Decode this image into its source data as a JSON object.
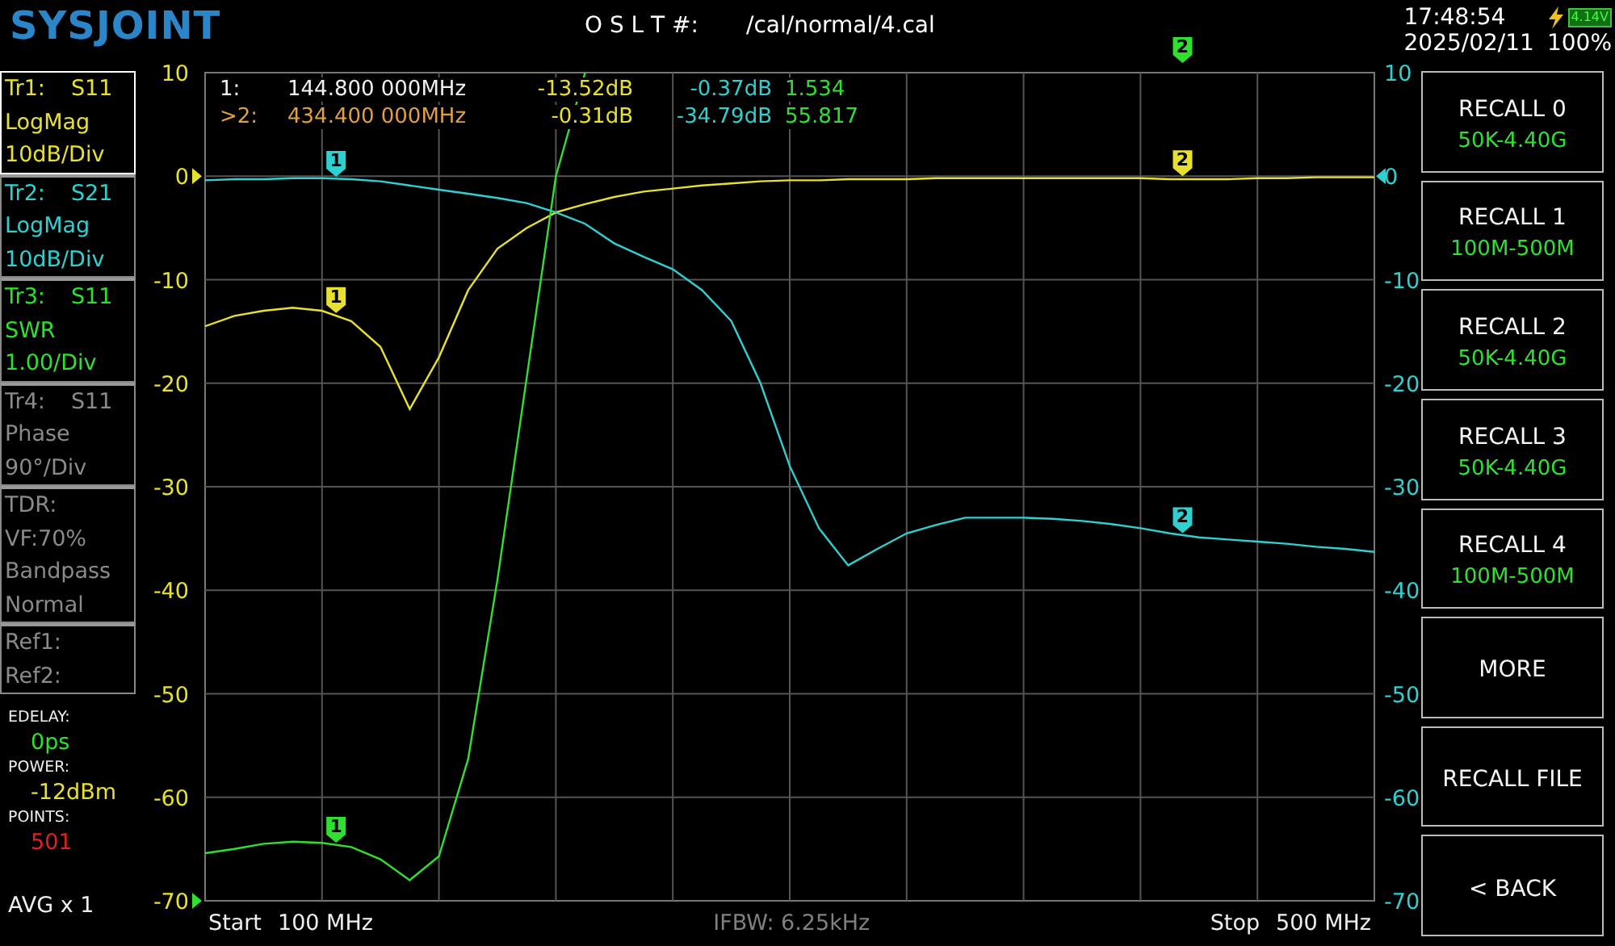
{
  "header": {
    "logo": "SYSJOINT",
    "cal_label": "O S L T #:",
    "cal_file": "/cal/normal/4.cal",
    "time": "17:48:54",
    "date": "2025/02/11",
    "battery_voltage": "4.14V",
    "battery_percent": "100%",
    "charging": true
  },
  "traces": [
    {
      "lines": [
        [
          "Tr1:",
          "S11"
        ],
        [
          "LogMag"
        ],
        [
          "10dB/Div"
        ]
      ],
      "color": "#e8e030",
      "selected": true
    },
    {
      "lines": [
        [
          "Tr2:",
          "S21"
        ],
        [
          "LogMag"
        ],
        [
          "10dB/Div"
        ]
      ],
      "color": "#30d0d0",
      "selected": false
    },
    {
      "lines": [
        [
          "Tr3:",
          "S11"
        ],
        [
          "SWR"
        ],
        [
          "1.00/Div"
        ]
      ],
      "color": "#30e030",
      "selected": false
    },
    {
      "lines": [
        [
          "Tr4:",
          "S11"
        ],
        [
          "Phase"
        ],
        [
          "90°/Div"
        ]
      ],
      "color": "#8a8a8a",
      "selected": false
    },
    {
      "lines": [
        [
          "TDR:"
        ],
        [
          "VF:70%"
        ],
        [
          "Bandpass"
        ],
        [
          "Normal"
        ]
      ],
      "color": "#8a8a8a",
      "selected": false
    },
    {
      "lines": [
        [
          "Ref1:"
        ],
        [
          "Ref2:"
        ]
      ],
      "color": "#8a8a8a",
      "selected": false
    }
  ],
  "settings": [
    {
      "label": "EDELAY:",
      "value": "0ps",
      "color": "#30e030"
    },
    {
      "label": "POWER:",
      "value": "-12dBm",
      "color": "#e8e030"
    },
    {
      "label": "POINTS:",
      "value": "501",
      "color": "#e02020"
    }
  ],
  "averaging": "AVG x 1",
  "plot": {
    "readouts": [
      {
        "label": "1:",
        "frequency": "144.800 000MHz",
        "values": [
          "-13.52dB",
          "-0.37dB",
          "1.534"
        ],
        "selected": false
      },
      {
        "label": ">2:",
        "frequency": "434.400 000MHz",
        "values": [
          "-0.31dB",
          "-34.79dB",
          "55.817"
        ],
        "selected": true
      }
    ],
    "right_ticks": [
      "10",
      "0",
      "-10",
      "-20",
      "-30",
      "-40",
      "-50",
      "-60",
      "-70"
    ],
    "markers": [
      {
        "label": "1",
        "color": "#30d0d0"
      },
      {
        "label": "1",
        "color": "#e8e030"
      },
      {
        "label": "1",
        "color": "#30e030"
      },
      {
        "label": "2",
        "color": "#30e030"
      },
      {
        "label": "2",
        "color": "#e8e030"
      },
      {
        "label": "2",
        "color": "#30d0d0"
      }
    ],
    "chart_data": {
      "type": "line",
      "grid": true,
      "ylim": [
        -70,
        10
      ],
      "yticks": [
        10,
        0,
        -10,
        -20,
        -30,
        -40,
        -50,
        -60,
        -70
      ],
      "categories": [
        null,
        null,
        null,
        null,
        null,
        null,
        null,
        null,
        null,
        null,
        null,
        null,
        null,
        null,
        null,
        null,
        null,
        null,
        null,
        null,
        null,
        null,
        null,
        null,
        null,
        null,
        null,
        null,
        null,
        null,
        null,
        null,
        null,
        null,
        null,
        null,
        null,
        null,
        null,
        null,
        null
      ],
      "series": [
        {
          "color": "#e8e030",
          "values": [
            -14.5,
            -13.5,
            -13,
            -12.7,
            -13,
            -14,
            -16.5,
            -22.5,
            -17.5,
            -11,
            -7,
            -5,
            -3.5,
            -2.7,
            -2,
            -1.5,
            -1.2,
            -0.9,
            -0.7,
            -0.5,
            -0.4,
            -0.4,
            -0.3,
            -0.3,
            -0.3,
            -0.2,
            -0.2,
            -0.2,
            -0.2,
            -0.2,
            -0.2,
            -0.2,
            -0.2,
            -0.3,
            -0.3,
            -0.3,
            -0.2,
            -0.2,
            -0.1,
            -0.1,
            -0.1
          ]
        },
        {
          "color": "#30d0d0",
          "values": [
            -0.4,
            -0.3,
            -0.3,
            -0.2,
            -0.2,
            -0.3,
            -0.5,
            -0.9,
            -1.3,
            -1.7,
            -2.1,
            -2.6,
            -3.5,
            -4.6,
            -6.5,
            -7.8,
            -9,
            -11,
            -14,
            -20,
            -28,
            -34,
            -37.6,
            -36,
            -34.5,
            -33.7,
            -33,
            -33,
            -33,
            -33.1,
            -33.3,
            -33.6,
            -34,
            -34.5,
            -34.9,
            -35.1,
            -35.3,
            -35.5,
            -35.8,
            -36,
            -36.3
          ]
        },
        {
          "color": "#30e030",
          "values": [
            -65.4,
            -65,
            -64.5,
            -64.3,
            -64.4,
            -64.8,
            -66,
            -68,
            -65.7,
            -56.3,
            -39,
            -19.5,
            0,
            10,
            null,
            null,
            null,
            null,
            null,
            null,
            null,
            null,
            null,
            null,
            null,
            null,
            null,
            null,
            null,
            null,
            null,
            null,
            null,
            null,
            null,
            null,
            null,
            null,
            null,
            null,
            null
          ]
        }
      ]
    },
    "start_label": "Start",
    "start": "100 MHz",
    "ifbw": "IFBW: 6.25kHz",
    "stop_label": "Stop",
    "stop": "500 MHz"
  },
  "buttons": [
    {
      "label": "RECALL 0",
      "detail": "50K-4.40G"
    },
    {
      "label": "RECALL 1",
      "detail": "100M-500M"
    },
    {
      "label": "RECALL 2",
      "detail": "50K-4.40G"
    },
    {
      "label": "RECALL 3",
      "detail": "50K-4.40G"
    },
    {
      "label": "RECALL 4",
      "detail": "100M-500M"
    },
    {
      "label": "MORE"
    },
    {
      "label": "RECALL FILE"
    },
    {
      "label": "< BACK"
    }
  ]
}
